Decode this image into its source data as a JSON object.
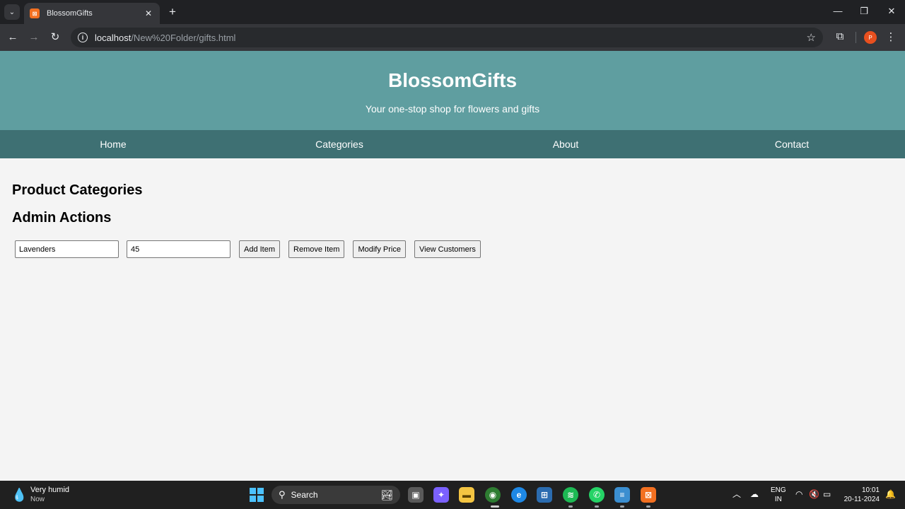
{
  "browser": {
    "tab_title": "BlossomGifts",
    "tab_favicon_text": "⊠",
    "url_host": "localhost",
    "url_path": "/New%20Folder/gifts.html",
    "profile_initial": "P"
  },
  "site": {
    "title": "BlossomGifts",
    "tagline": "Your one-stop shop for flowers and gifts",
    "nav": [
      "Home",
      "Categories",
      "About",
      "Contact"
    ]
  },
  "content": {
    "categories_heading": "Product Categories",
    "admin_heading": "Admin Actions",
    "item_name_value": "Lavenders",
    "price_value": "45",
    "buttons": {
      "add": "Add Item",
      "remove": "Remove Item",
      "modify": "Modify Price",
      "view": "View Customers"
    }
  },
  "taskbar": {
    "weather_title": "Very humid",
    "weather_sub": "Now",
    "search_label": "Search",
    "lang_top": "ENG",
    "lang_bottom": "IN",
    "time": "10:01",
    "date": "20-11-2024"
  },
  "colors": {
    "header_bg": "#5f9ea0",
    "nav_bg": "#3e7073",
    "page_bg": "#f4f4f4"
  }
}
